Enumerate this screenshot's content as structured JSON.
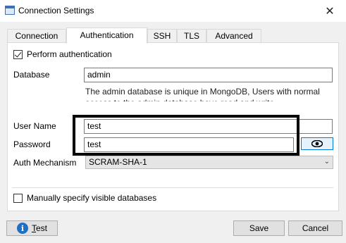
{
  "window": {
    "title": "Connection Settings",
    "close_glyph": "✕"
  },
  "tabs": [
    {
      "label": "Connection"
    },
    {
      "label": "Authentication",
      "active": true
    },
    {
      "label": "SSH"
    },
    {
      "label": "TLS"
    },
    {
      "label": "Advanced"
    }
  ],
  "auth": {
    "perform_label": "Perform authentication",
    "perform_checked": true,
    "database_label": "Database",
    "database_value": "admin",
    "database_help": "The admin database is unique in MongoDB, Users with normal access to the admin database have read and write",
    "username_label": "User Name",
    "username_value": "test",
    "password_label": "Password",
    "password_value": "test",
    "mechanism_label": "Auth Mechanism",
    "mechanism_value": "SCRAM-SHA-1",
    "visible_db_label": "Manually specify visible databases",
    "visible_db_checked": false
  },
  "buttons": {
    "test_first": "T",
    "test_rest": "est",
    "save": "Save",
    "cancel": "Cancel"
  },
  "colors": {
    "accent": "#0078d7",
    "highlight_box": "#000000"
  }
}
